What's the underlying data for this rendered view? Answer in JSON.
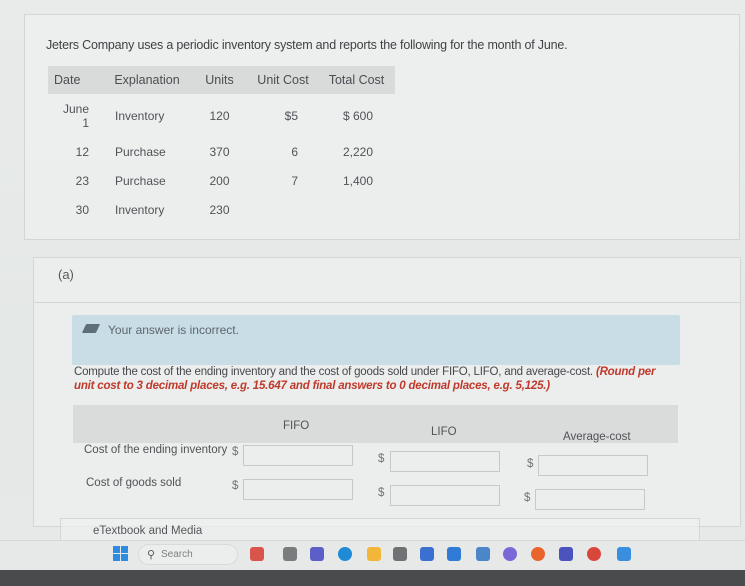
{
  "problem": {
    "intro": "Jeters Company uses a periodic inventory system and reports the following for the month of June.",
    "table": {
      "headers": [
        "Date",
        "Explanation",
        "Units",
        "Unit Cost",
        "Total Cost"
      ],
      "rows": [
        {
          "date": "June 1",
          "explanation": "Inventory",
          "units": "120",
          "unit_cost": "$5",
          "total_cost": "$ 600"
        },
        {
          "date": "12",
          "explanation": "Purchase",
          "units": "370",
          "unit_cost": "6",
          "total_cost": "2,220"
        },
        {
          "date": "23",
          "explanation": "Purchase",
          "units": "200",
          "unit_cost": "7",
          "total_cost": "1,400"
        },
        {
          "date": "30",
          "explanation": "Inventory",
          "units": "230",
          "unit_cost": "",
          "total_cost": ""
        }
      ]
    }
  },
  "part_a": {
    "label": "(a)",
    "feedback": {
      "icon": "pencil-icon",
      "message": "Your answer is incorrect.",
      "background": "#c9dde6"
    },
    "instructions": "Compute the cost of the ending inventory and the cost of goods sold under FIFO, LIFO, and average-cost.",
    "rounding_note": "(Round per unit cost to 3 decimal places, e.g. 15.647 and final answers to 0 decimal places, e.g. 5,125.)",
    "rounding_color": "#c0392b",
    "columns": [
      "FIFO",
      "LIFO",
      "Average-cost"
    ],
    "rows": [
      {
        "label": "Cost of the ending inventory",
        "currency": "$",
        "values": [
          "",
          "",
          ""
        ]
      },
      {
        "label": "Cost of goods sold",
        "currency": "$",
        "values": [
          "",
          "",
          ""
        ]
      }
    ]
  },
  "etextbook": {
    "label": "eTextbook and Media"
  },
  "taskbar": {
    "search_placeholder": "Search",
    "apps": [
      {
        "name": "stack-app-icon",
        "color": "#d9544a"
      },
      {
        "name": "task-view-icon",
        "color": "#7a7c7e"
      },
      {
        "name": "teams-icon",
        "color": "#5b5fc7"
      },
      {
        "name": "edge-icon",
        "color": "#1f8ad6"
      },
      {
        "name": "file-explorer-icon",
        "color": "#f2b739"
      },
      {
        "name": "dropbox-icon",
        "color": "#6f7174"
      },
      {
        "name": "microsoft-store-icon",
        "color": "#3b6fd0"
      },
      {
        "name": "mail-icon",
        "color": "#2f7bd6"
      },
      {
        "name": "amazon-icon",
        "color": "#4a86c8"
      },
      {
        "name": "copilot-icon",
        "color": "#7a67d8"
      },
      {
        "name": "firefox-icon",
        "color": "#e8642c"
      },
      {
        "name": "teams-new-icon",
        "color": "#4b53bc"
      },
      {
        "name": "chrome-icon",
        "color": "#d9473c"
      },
      {
        "name": "photos-icon",
        "color": "#3a8ee0"
      }
    ]
  }
}
